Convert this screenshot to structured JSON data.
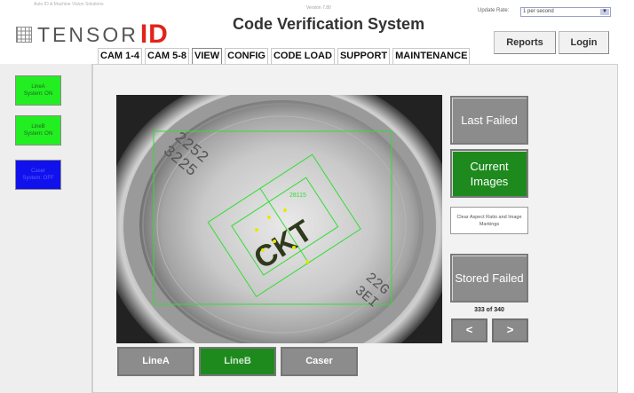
{
  "header": {
    "brand_tag": "Auto ID & Machine Vision Solutions",
    "logo_text": "TENSOR",
    "logo_id": "ID",
    "version": "Version 7.80",
    "title": "Code Verification System",
    "update_rate_label": "Update Rate:",
    "update_rate_value": "1 per second",
    "reports_label": "Reports",
    "login_label": "Login"
  },
  "tabs": [
    "CAM 1-4",
    "CAM 5-8",
    "VIEW",
    "CONFIG",
    "CODE LOAD",
    "SUPPORT",
    "MAINTENANCE"
  ],
  "active_tab": "VIEW",
  "line_status": [
    {
      "name": "LineA",
      "status": "System: ON",
      "state": "on"
    },
    {
      "name": "LineB",
      "status": "System: ON",
      "state": "on"
    },
    {
      "name": "Caser",
      "status": "System: OFF",
      "state": "off"
    }
  ],
  "controls": {
    "last_failed": "Last Failed",
    "current_images": "Current Images",
    "clear_aspect": "Clear Aspect Ratio and Image Markings",
    "stored_failed": "Stored Failed",
    "counter": "333 of 340",
    "prev": "<",
    "next": ">"
  },
  "camera": {
    "overlay_label": "28115",
    "printed_code": "CKT"
  },
  "line_buttons": [
    {
      "label": "LineA",
      "state": "gray"
    },
    {
      "label": "LineB",
      "state": "green"
    },
    {
      "label": "Caser",
      "state": "gray"
    }
  ],
  "colors": {
    "status_on": "#22ee22",
    "status_off": "#1111ee",
    "button_green": "#1e8a1e",
    "button_gray": "#8c8c8c",
    "brand_red": "#e2231a",
    "overlay_green": "#33dd33"
  }
}
